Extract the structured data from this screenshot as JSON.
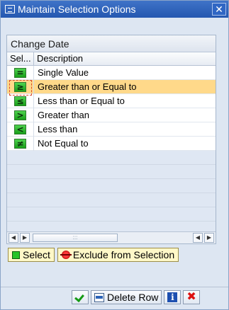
{
  "window": {
    "title": "Maintain Selection Options",
    "close_glyph": "✕"
  },
  "table": {
    "title": "Change Date",
    "columns": {
      "sel": "Sel...",
      "description": "Description"
    },
    "rows": [
      {
        "sign": "=",
        "label": "Single Value",
        "selected": false
      },
      {
        "sign": "≥",
        "label": "Greater than or Equal to",
        "selected": true
      },
      {
        "sign": "≤",
        "label": "Less than or Equal to",
        "selected": false
      },
      {
        "sign": ">",
        "label": "Greater than",
        "selected": false
      },
      {
        "sign": "<",
        "label": "Less than",
        "selected": false
      },
      {
        "sign": "≠",
        "label": "Not Equal to",
        "selected": false
      }
    ],
    "scroll": {
      "left_arrow": "◀",
      "right_arrow": "▶",
      "thumb_grip": ":::"
    }
  },
  "actions": {
    "select_label": "Select",
    "exclude_label": "Exclude from Selection"
  },
  "toolbar": {
    "delete_row_label": "Delete Row",
    "info_glyph": "i",
    "cancel_glyph": "✖"
  },
  "colors": {
    "titlebar": "#2457b0",
    "selected_row": "#ffd98a",
    "sign_green": "#19a019",
    "action_button_bg": "#fff8c8"
  },
  "icons": {
    "title": "window-icon",
    "ok": "checkmark-icon",
    "delete_row": "delete-row-icon",
    "info": "info-icon",
    "cancel": "cancel-icon"
  }
}
